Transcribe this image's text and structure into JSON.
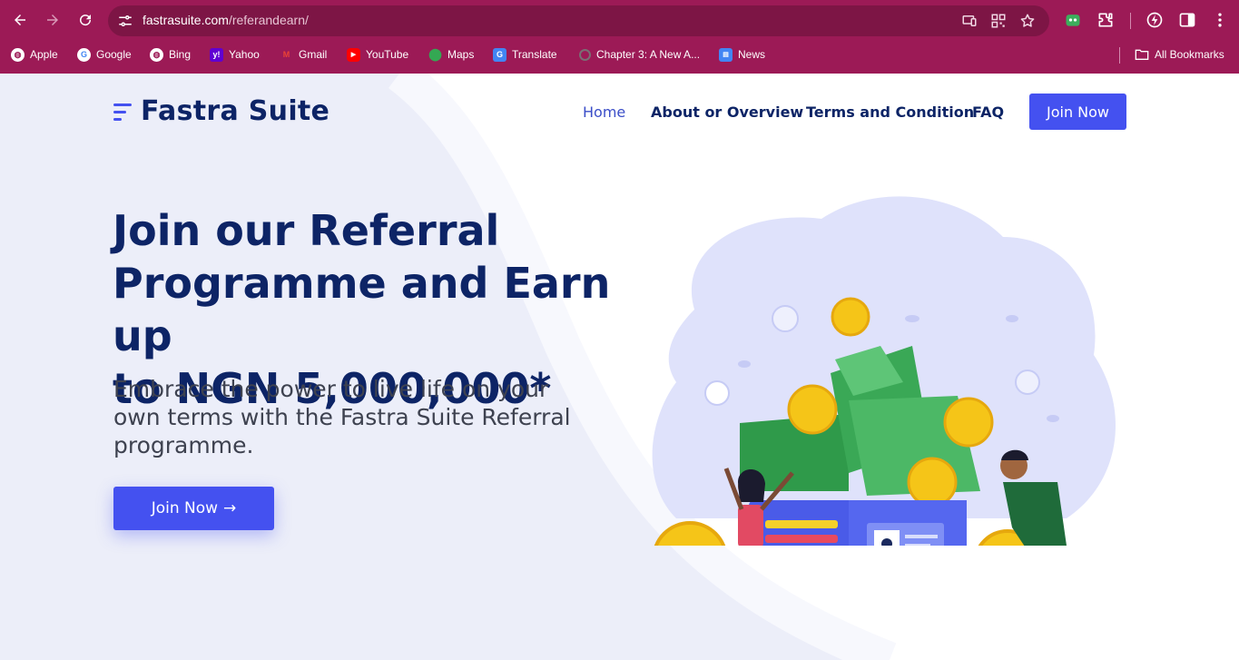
{
  "browser": {
    "url_domain": "fastrasuite.com",
    "url_path": "/referandearn/",
    "bookmarks": [
      {
        "label": "Apple",
        "icon": "globe-icon"
      },
      {
        "label": "Google",
        "icon": "google-icon"
      },
      {
        "label": "Bing",
        "icon": "globe-icon"
      },
      {
        "label": "Yahoo",
        "icon": "yahoo-icon"
      },
      {
        "label": "Gmail",
        "icon": "gmail-icon"
      },
      {
        "label": "YouTube",
        "icon": "youtube-icon"
      },
      {
        "label": "Maps",
        "icon": "maps-icon"
      },
      {
        "label": "Translate",
        "icon": "translate-icon"
      },
      {
        "label": "Chapter 3: A New A...",
        "icon": "loading-icon"
      },
      {
        "label": "News",
        "icon": "news-icon"
      }
    ],
    "all_bookmarks": "All Bookmarks"
  },
  "site": {
    "logo_text": "Fastra Suite",
    "nav": {
      "home": "Home",
      "about": "About or Overview",
      "terms": "Terms and Condition",
      "faq": "FAQ",
      "join": "Join Now"
    }
  },
  "hero": {
    "title_line1": "Join our Referral",
    "title_line2": "Programme and Earn up",
    "title_line3": "to NGN 5,000,000*",
    "subtitle": "Embrace the power to live life on your own terms with the Fastra Suite Referral programme.",
    "cta": "Join Now",
    "cta_arrow": "→"
  },
  "colors": {
    "chrome": "#9c1a56",
    "brand_blue": "#4451f0",
    "heading": "#0d2466"
  }
}
